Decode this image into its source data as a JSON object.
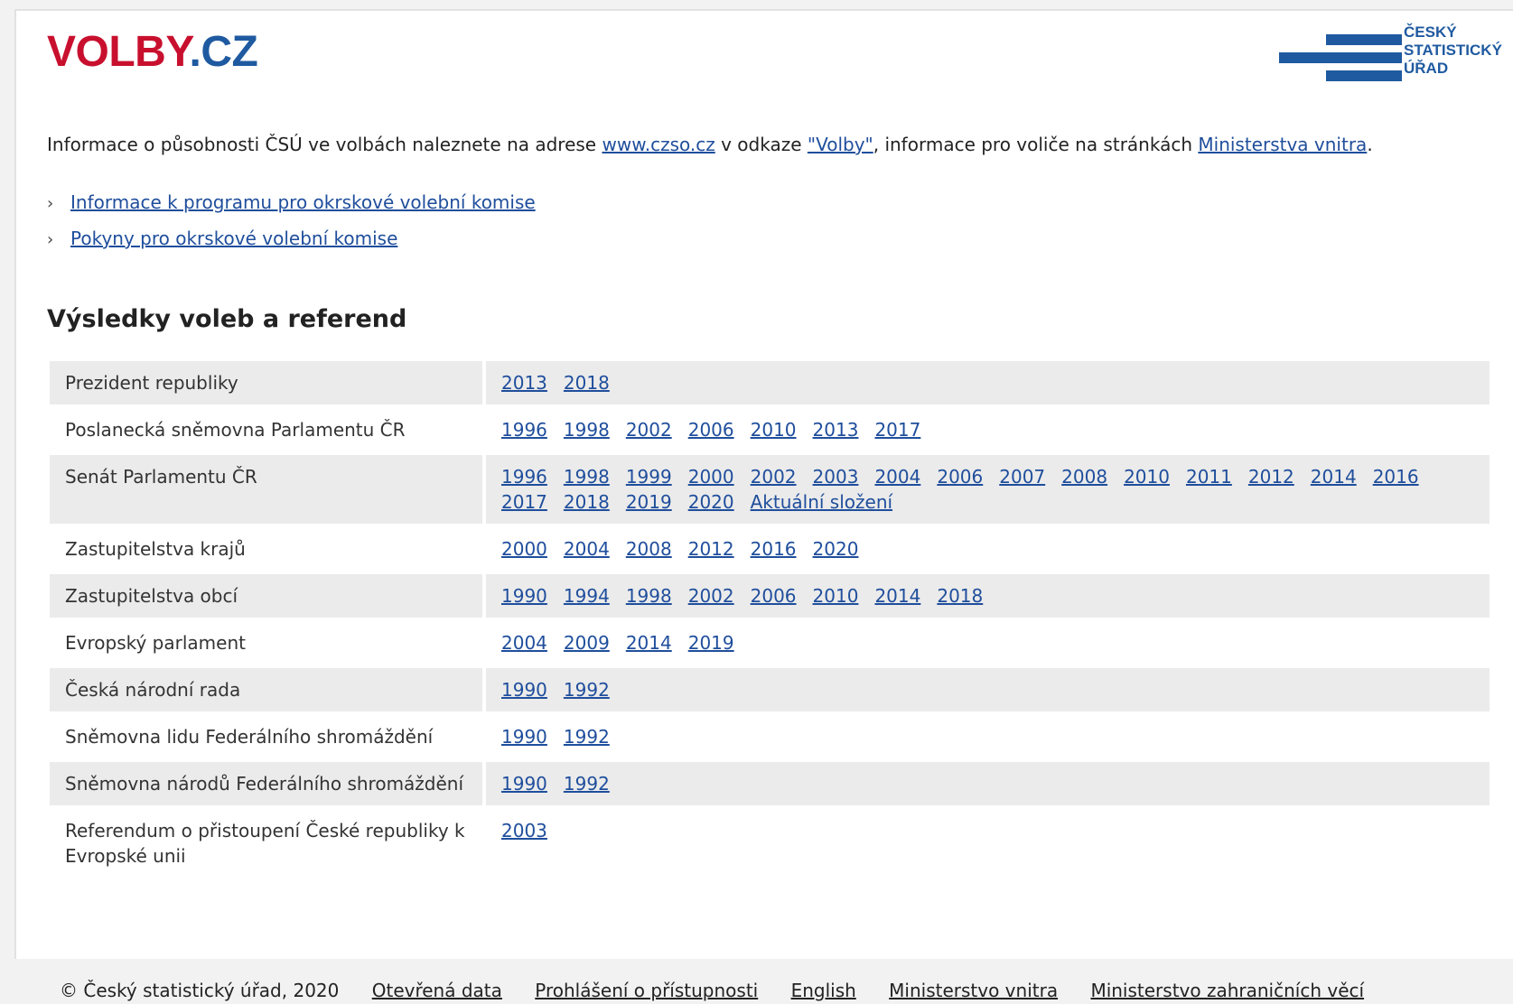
{
  "header": {
    "logo_part1": "VOLBY",
    "logo_part2": ".CZ",
    "csu_line1": "ČESKÝ",
    "csu_line2": "STATISTICKÝ",
    "csu_line3": "ÚŘAD"
  },
  "info": {
    "text1": "Informace o působnosti ČSÚ ve volbách naleznete na adrese ",
    "link1": "www.czso.cz",
    "text2": " v odkaze ",
    "link2": "\"Volby\"",
    "text3": ", informace pro voliče na stránkách ",
    "link3": "Ministerstva vnitra",
    "text4": "."
  },
  "links": [
    "Informace k programu pro okrskové volební komise",
    "Pokyny pro okrskové volební komise"
  ],
  "heading": "Výsledky voleb a referend",
  "rows": [
    {
      "label": "Prezident republiky",
      "years": [
        "2013",
        "2018"
      ]
    },
    {
      "label": "Poslanecká sněmovna Parlamentu ČR",
      "years": [
        "1996",
        "1998",
        "2002",
        "2006",
        "2010",
        "2013",
        "2017"
      ]
    },
    {
      "label": "Senát Parlamentu ČR",
      "years": [
        "1996",
        "1998",
        "1999",
        "2000",
        "2002",
        "2003",
        "2004",
        "2006",
        "2007",
        "2008",
        "2010",
        "2011",
        "2012",
        "2014",
        "2016",
        "2017",
        "2018",
        "2019",
        "2020",
        "Aktuální složení"
      ]
    },
    {
      "label": "Zastupitelstva krajů",
      "years": [
        "2000",
        "2004",
        "2008",
        "2012",
        "2016",
        "2020"
      ]
    },
    {
      "label": "Zastupitelstva obcí",
      "years": [
        "1990",
        "1994",
        "1998",
        "2002",
        "2006",
        "2010",
        "2014",
        "2018"
      ]
    },
    {
      "label": "Evropský parlament",
      "years": [
        "2004",
        "2009",
        "2014",
        "2019"
      ]
    },
    {
      "label": "Česká národní rada",
      "years": [
        "1990",
        "1992"
      ]
    },
    {
      "label": "Sněmovna lidu Federálního shromáždění",
      "years": [
        "1990",
        "1992"
      ]
    },
    {
      "label": "Sněmovna národů Federálního shromáždění",
      "years": [
        "1990",
        "1992"
      ]
    },
    {
      "label": "Referendum o přistoupení České republiky k Evropské unii",
      "years": [
        "2003"
      ]
    }
  ],
  "footer": {
    "copyright": "© Český statistický úřad, 2020",
    "links": [
      "Otevřená data",
      "Prohlášení o přístupnosti",
      "English",
      "Ministerstvo vnitra",
      "Ministerstvo zahraničních věcí"
    ]
  }
}
